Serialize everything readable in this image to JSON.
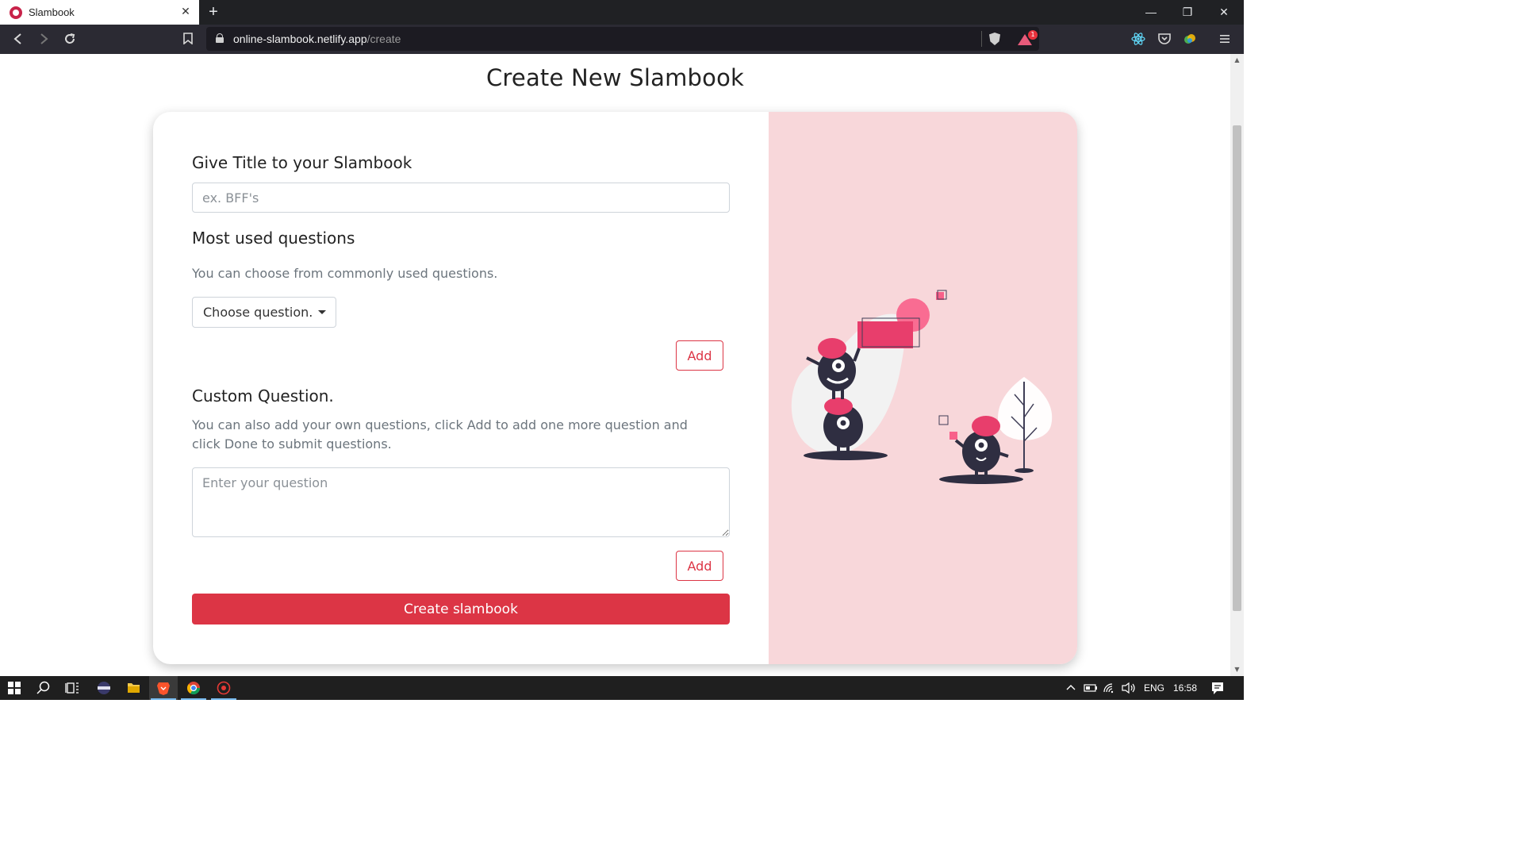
{
  "browser": {
    "tab_title": "Slambook",
    "tab_close": "✕",
    "new_tab": "+",
    "url_host": "online-slambook.netlify.app",
    "url_path": "/create",
    "rewards_badge": "1",
    "window_controls": {
      "minimize": "—",
      "restore": "❐",
      "close": "✕"
    }
  },
  "page": {
    "title": "Create New Slambook"
  },
  "form": {
    "title_section": {
      "heading": "Give Title to your Slambook",
      "placeholder": "ex. BFF's"
    },
    "most_used": {
      "heading": "Most used questions",
      "help": "You can choose from commonly used questions.",
      "dropdown_label": "Choose question.",
      "add_label": "Add"
    },
    "custom": {
      "heading": "Custom Question.",
      "help": "You can also add your own questions, click Add to add one more question and click Done to submit questions.",
      "placeholder": "Enter your question",
      "add_label": "Add"
    },
    "submit_label": "Create slambook"
  },
  "taskbar": {
    "language": "ENG",
    "time": "16:58"
  },
  "colors": {
    "accent": "#dc3545",
    "illustration_bg": "#f8d7da",
    "monster_dark": "#2f2e41",
    "monster_accent": "#e83e6c"
  }
}
